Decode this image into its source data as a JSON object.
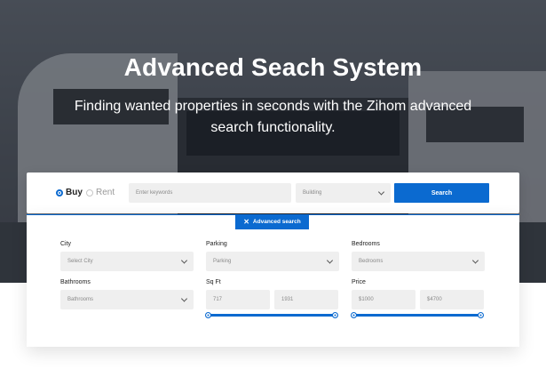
{
  "hero": {
    "title": "Advanced Seach System",
    "subtitle": "Finding wanted properties in seconds with the Zihom advanced search functionality."
  },
  "search_bar": {
    "options": [
      {
        "label": "Buy",
        "selected": true
      },
      {
        "label": "Rent",
        "selected": false
      }
    ],
    "keyword_placeholder": "Enter keywords",
    "type_value": "Building",
    "search_label": "Search"
  },
  "advanced": {
    "tab_label": "Advanced search",
    "city": {
      "label": "City",
      "value": "Select City"
    },
    "parking": {
      "label": "Parking",
      "value": "Parking"
    },
    "bedrooms": {
      "label": "Bedrooms",
      "value": "Bedrooms"
    },
    "bathrooms": {
      "label": "Bathrooms",
      "value": "Bathrooms"
    },
    "sqft": {
      "label": "Sq Ft",
      "min": "717",
      "max": "1931"
    },
    "price": {
      "label": "Price",
      "min": "$1000",
      "max": "$4700"
    }
  },
  "colors": {
    "accent": "#0b6ad0",
    "field_bg": "#efefef"
  }
}
